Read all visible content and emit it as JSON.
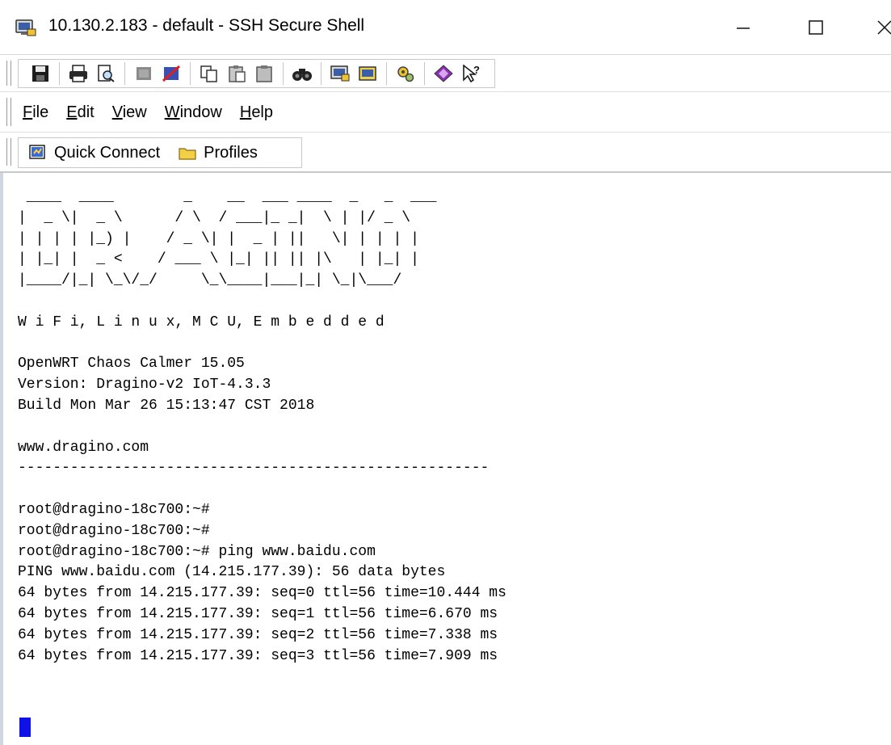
{
  "window": {
    "title": "10.130.2.183 - default - SSH Secure Shell",
    "icon": "ssh-client-icon",
    "controls": [
      "minimize-icon",
      "maximize-icon",
      "close-icon"
    ]
  },
  "toolbar": {
    "groups": [
      [
        "save-icon"
      ],
      [
        "print-icon",
        "print-preview-icon"
      ],
      [
        "disconnect-icon",
        "disconnect-red-icon"
      ],
      [
        "copy-icon",
        "paste-icon",
        "paste-clipboard-icon"
      ],
      [
        "find-icon"
      ],
      [
        "new-window-icon",
        "settings-window-icon"
      ],
      [
        "settings-icon"
      ],
      [
        "help-book-icon",
        "context-help-icon"
      ]
    ]
  },
  "menubar": {
    "items": [
      {
        "key": "F",
        "rest": "ile"
      },
      {
        "key": "E",
        "rest": "dit"
      },
      {
        "key": "V",
        "rest": "iew"
      },
      {
        "key": "W",
        "rest": "indow"
      },
      {
        "key": "H",
        "rest": "elp"
      }
    ]
  },
  "connectbar": {
    "quick_connect": "Quick Connect",
    "profiles": "Profiles"
  },
  "terminal": {
    "lines": [
      " ____  ____        _    __  ___ ____  _   _  ___",
      "|  _ \\|  _ \\      / \\  / ___|_ _|  \\ | |/ _ \\",
      "| | | | |_) |    / _ \\| |  _ | ||   \\| | | | |",
      "| |_| |  _ <    / ___ \\ |_| || || |\\   | |_| |",
      "|____/|_| \\_\\/_/     \\_\\____|___|_| \\_|\\___/",
      "",
      "W i F i, L i n u x, M C U, E m b e d d e d",
      "",
      "OpenWRT Chaos Calmer 15.05",
      "Version: Dragino-v2 IoT-4.3.3",
      "Build Mon Mar 26 15:13:47 CST 2018",
      "",
      "www.dragino.com",
      "------------------------------------------------------",
      "",
      "root@dragino-18c700:~#",
      "root@dragino-18c700:~#",
      "root@dragino-18c700:~# ping www.baidu.com",
      "PING www.baidu.com (14.215.177.39): 56 data bytes",
      "64 bytes from 14.215.177.39: seq=0 ttl=56 time=10.444 ms",
      "64 bytes from 14.215.177.39: seq=1 ttl=56 time=6.670 ms",
      "64 bytes from 14.215.177.39: seq=2 ttl=56 time=7.338 ms",
      "64 bytes from 14.215.177.39: seq=3 ttl=56 time=7.909 ms"
    ],
    "cursor_color": "#1010e8"
  }
}
